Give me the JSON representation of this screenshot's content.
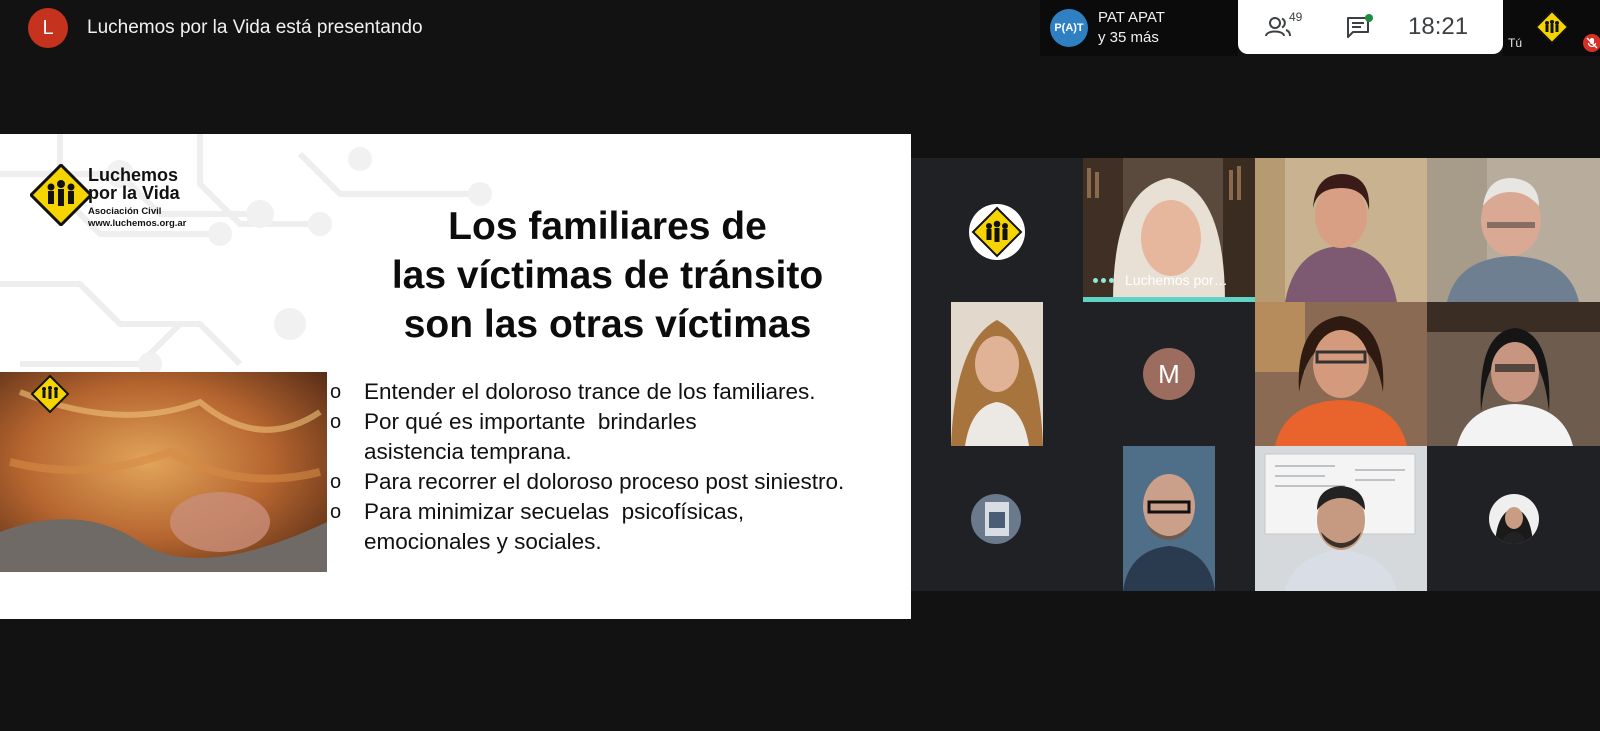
{
  "presenter": {
    "initial": "L",
    "label": "Luchemos por la Vida está presentando"
  },
  "group": {
    "avatar_text": "P(A)T",
    "name": "PAT APAT",
    "more": "y 35 más"
  },
  "controls": {
    "people_count": "49",
    "time": "18:21"
  },
  "self": {
    "label": "Tú"
  },
  "slide": {
    "logo_main_line1": "Luchemos",
    "logo_main_line2": "por la Vida",
    "logo_sub": "Asociación Civil",
    "logo_url": "www.luchemos.org.ar",
    "title_line1": "Los familiares de",
    "title_line2": "las víctimas de tránsito",
    "title_line3": "son las otras víctimas",
    "bullets": [
      {
        "mark": "o",
        "line1": "Entender el doloroso trance de los familiares.",
        "line2": ""
      },
      {
        "mark": "o",
        "line1": "Por qué es importante  brindarles",
        "line2": "asistencia temprana."
      },
      {
        "mark": "o",
        "line1": "Para recorrer el doloroso proceso post siniestro.",
        "line2": ""
      },
      {
        "mark": "o",
        "line1": "Para minimizar secuelas  psicofísicas,",
        "line2": "emocionales y sociales."
      }
    ]
  },
  "participants": {
    "active_name": "Luchemos por…",
    "m_initial": "M"
  },
  "colors": {
    "presenter_avatar": "#c5321e",
    "group_avatar": "#2f7fc3",
    "active_speaker": "#5fd3c4",
    "logo_yellow": "#f5d400",
    "mute": "#d93025"
  }
}
